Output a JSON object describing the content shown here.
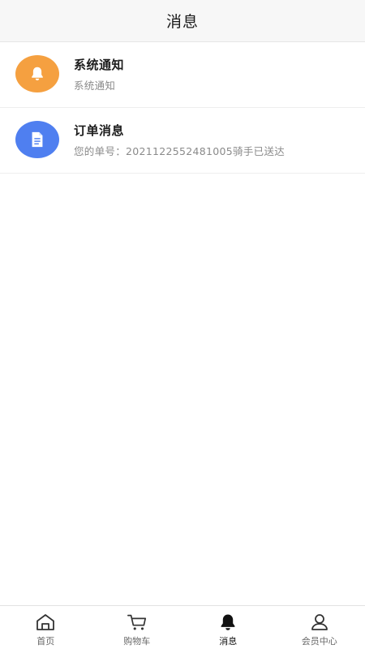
{
  "header": {
    "title": "消息"
  },
  "messages": [
    {
      "title": "系统通知",
      "subtitle": "系统通知",
      "icon": "bell-icon",
      "color": "#f5a040"
    },
    {
      "title": "订单消息",
      "subtitle": "您的单号：2021122552481005骑手已送达",
      "icon": "document-icon",
      "color": "#4f7ff0"
    }
  ],
  "tabbar": {
    "active": "消息",
    "items": [
      {
        "label": "首页",
        "icon": "home-icon"
      },
      {
        "label": "购物车",
        "icon": "cart-icon"
      },
      {
        "label": "消息",
        "icon": "bell-icon"
      },
      {
        "label": "会员中心",
        "icon": "user-icon"
      }
    ]
  },
  "colors": {
    "header_bg": "#f7f7f7",
    "orange": "#f5a040",
    "blue": "#4f7ff0",
    "subtext": "#8a8a8a"
  }
}
